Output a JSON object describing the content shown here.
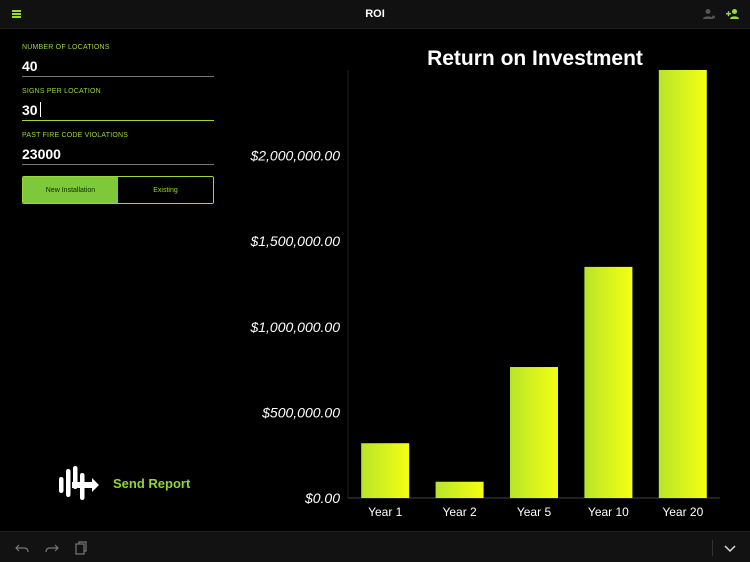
{
  "header": {
    "title": "ROI",
    "menu_icon": "hamburger-menu-icon",
    "right_icons": [
      "person-icon",
      "add-user-icon"
    ],
    "accent_color": "#9bd83a"
  },
  "form": {
    "fields": [
      {
        "label": "NUMBER OF LOCATIONS",
        "value": "40"
      },
      {
        "label": "SIGNS PER LOCATION",
        "value": "30"
      },
      {
        "label": "PAST FIRE CODE VIOLATIONS",
        "value": "23000"
      }
    ],
    "installation_type": {
      "options": [
        "New Installation",
        "Existing"
      ],
      "selected": "New Installation"
    }
  },
  "send_report": {
    "label": "Send Report",
    "icon": "company-logo-icon"
  },
  "chart_data": {
    "type": "bar",
    "title": "Return on Investment",
    "categories": [
      "Year 1",
      "Year 2",
      "Year 5",
      "Year 10",
      "Year 20"
    ],
    "values": [
      320000,
      95000,
      765000,
      1350000,
      2500000
    ],
    "ylim": [
      0,
      2500000
    ],
    "yticks": [
      0,
      500000,
      1000000,
      1500000,
      2000000
    ],
    "ytick_labels": [
      "$0.00",
      "$500,000.00",
      "$1,000,000.00",
      "$1,500,000.00",
      "$2,000,000.00"
    ],
    "xlabel": "",
    "ylabel": "",
    "grid": false,
    "bar_gradient": [
      "#b8e52a",
      "#f5ff12"
    ]
  },
  "toolbar": {
    "icons": [
      "undo-icon",
      "redo-icon",
      "paste-icon",
      "chevron-down-icon"
    ]
  }
}
